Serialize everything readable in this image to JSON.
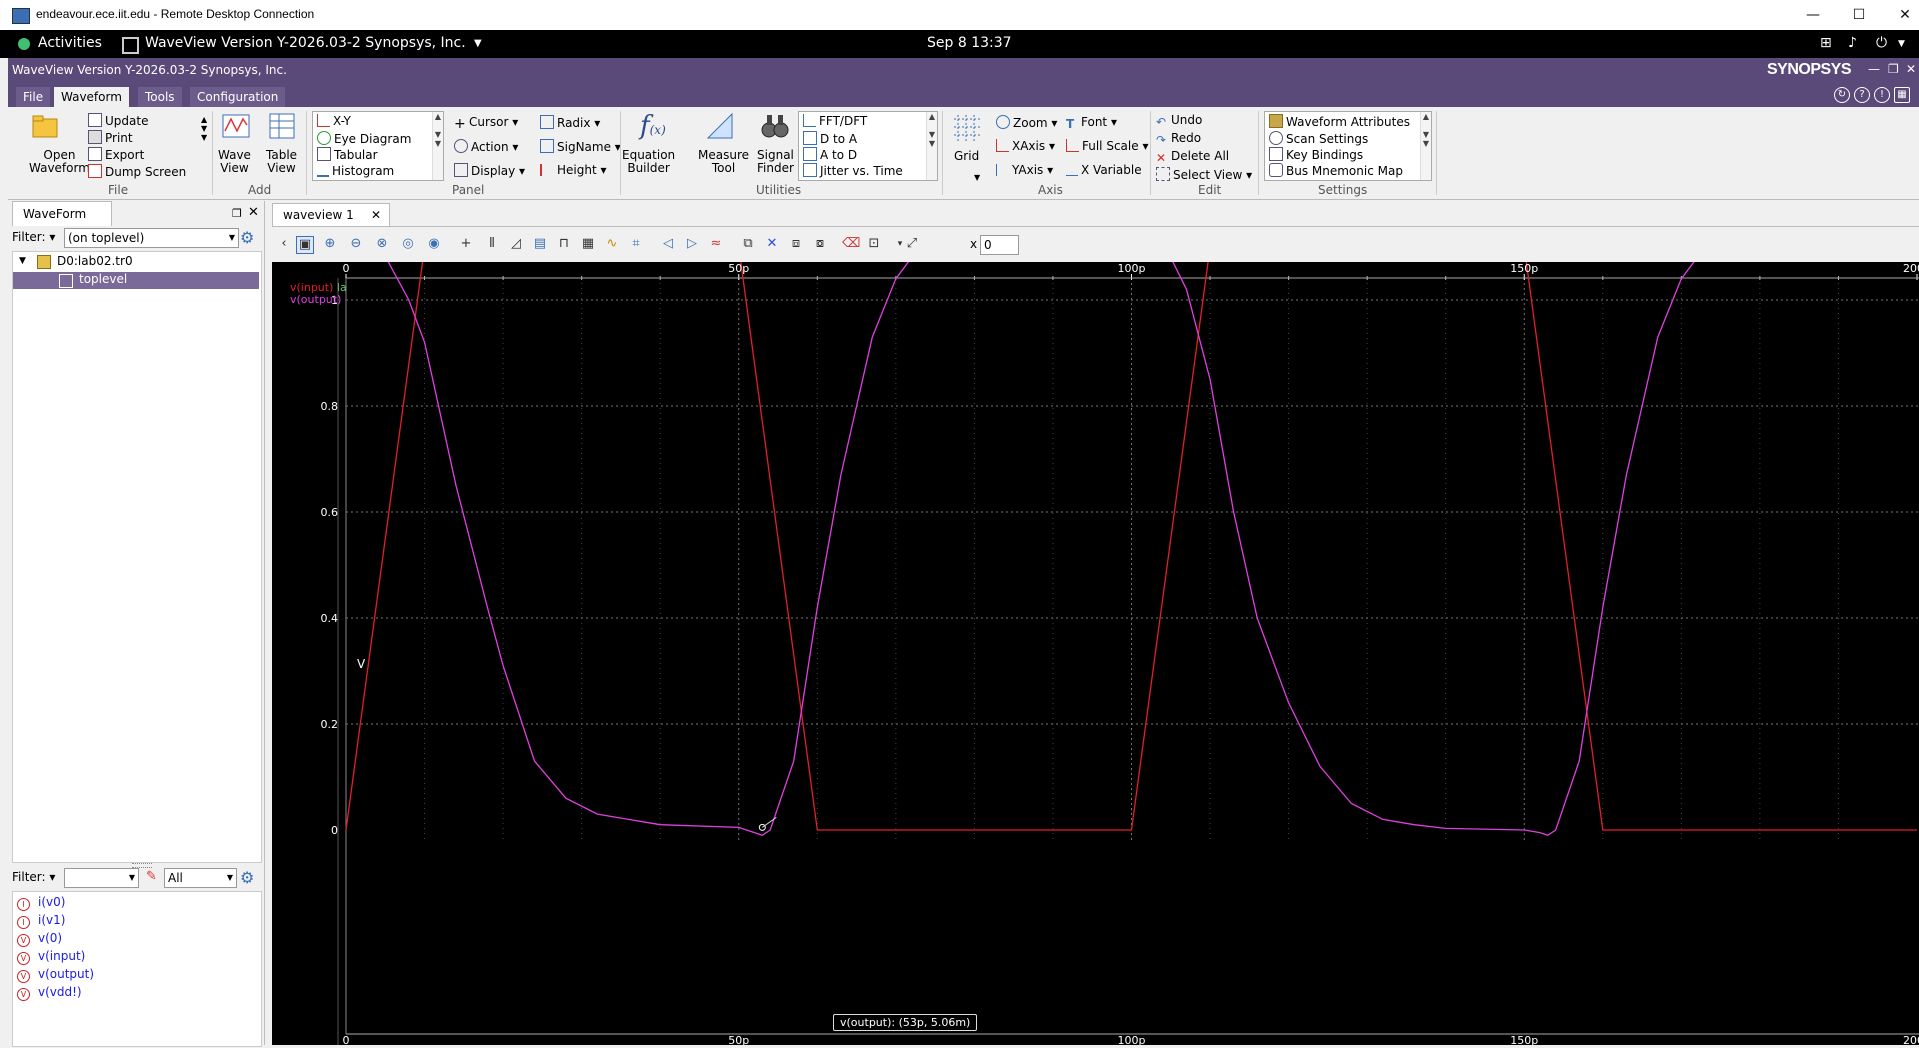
{
  "rdp": {
    "title": "endeavour.ece.iit.edu - Remote Desktop Connection",
    "min": "—",
    "max": "☐",
    "close": "✕"
  },
  "gnome": {
    "activities": "Activities",
    "app": "WaveView Version Y-2026.03-2 Synopsys, Inc.",
    "clock": "Sep 8  13:37"
  },
  "app": {
    "title": "WaveView Version Y-2026.03-2 Synopsys, Inc.",
    "logo": "SYNOPSYS"
  },
  "menu": [
    "File",
    "Waveform",
    "Tools",
    "Configuration"
  ],
  "ribbon": {
    "file": {
      "open": [
        "Open",
        "Waveform"
      ],
      "items": [
        "Update",
        "Print",
        "Export",
        "Dump Screen"
      ],
      "group": "File"
    },
    "add": {
      "wave": [
        "Wave",
        "View"
      ],
      "table": [
        "Table",
        "View"
      ],
      "group": "Add"
    },
    "panel": {
      "list": [
        "X-Y",
        "Eye Diagram",
        "Tabular",
        "Histogram"
      ],
      "col1": [
        "Cursor",
        "Action",
        "Display"
      ],
      "col2": [
        "Radix",
        "SigName",
        "Height"
      ],
      "group": "Panel"
    },
    "utilities": {
      "eq": [
        "Equation",
        "Builder"
      ],
      "measure": [
        "Measure",
        "Tool"
      ],
      "signal": [
        "Signal",
        "Finder"
      ],
      "list": [
        "FFT/DFT",
        "D to A",
        "A to D",
        "Jitter vs. Time"
      ],
      "group": "Utilities"
    },
    "axis": {
      "grid": "Grid",
      "col1": [
        "Zoom",
        "XAxis",
        "YAxis"
      ],
      "col2": [
        "Font",
        "Full Scale",
        "X Variable"
      ],
      "group": "Axis"
    },
    "edit": {
      "items": [
        "Undo",
        "Redo",
        "Delete All",
        "Select View"
      ],
      "group": "Edit"
    },
    "settings": {
      "items": [
        "Waveform Attributes",
        "Scan Settings",
        "Key Bindings",
        "Bus Mnemonic Map"
      ],
      "group": "Settings"
    }
  },
  "left": {
    "tab": "WaveForm",
    "filter_label": "Filter:",
    "filter_value": "(on toplevel)",
    "tree": [
      "D0:lab02.tr0",
      "toplevel"
    ],
    "filter2_label": "Filter:",
    "filter2_all": "All",
    "signals": [
      "i(v0)",
      "i(v1)",
      "v(0)",
      "v(input)",
      "v(output)",
      "v(vdd!)"
    ]
  },
  "wave": {
    "tab": "waveview 1",
    "x_label": "x",
    "x_value": "0"
  },
  "chart_data": {
    "type": "line",
    "ylabel": "V",
    "xlabel": "",
    "xlim": [
      0,
      200
    ],
    "ylim": [
      0,
      1.1
    ],
    "x_ticks": [
      "0",
      "50p",
      "100p",
      "150p",
      "200p"
    ],
    "y_ticks": [
      "0",
      "0.2",
      "0.4",
      "0.6",
      "0.8",
      "1"
    ],
    "grid": true,
    "legend": [
      "v(input)",
      "v(output)"
    ],
    "legend_extra": "la",
    "series": [
      {
        "name": "v(input)",
        "color": "#e0202a",
        "x": [
          0,
          10,
          50,
          60,
          100,
          110,
          150,
          160,
          200
        ],
        "y": [
          0,
          1.1,
          1.1,
          0,
          0,
          1.1,
          1.1,
          0,
          0
        ]
      },
      {
        "name": "v(output)",
        "color": "#e040e0",
        "x": [
          0,
          2,
          4,
          8,
          10,
          14,
          18,
          20,
          24,
          28,
          32,
          40,
          50,
          52,
          53,
          54,
          57,
          60,
          63,
          65,
          67,
          70,
          72,
          75,
          80,
          90,
          100,
          102,
          103,
          104,
          107,
          110,
          113,
          116,
          120,
          124,
          128,
          132,
          136,
          140,
          150,
          152,
          153,
          154,
          157,
          160,
          163,
          165,
          167,
          170,
          172,
          175,
          180,
          190,
          200
        ],
        "y": [
          1.08,
          1.11,
          1.11,
          1.0,
          0.92,
          0.65,
          0.42,
          0.31,
          0.13,
          0.06,
          0.03,
          0.01,
          0.005,
          -0.005,
          -0.01,
          0.0,
          0.13,
          0.42,
          0.67,
          0.8,
          0.93,
          1.04,
          1.08,
          1.095,
          1.1,
          1.1,
          1.1,
          1.12,
          1.13,
          1.11,
          1.02,
          0.85,
          0.6,
          0.4,
          0.24,
          0.12,
          0.05,
          0.02,
          0.01,
          0.003,
          0.0,
          -0.005,
          -0.01,
          0.0,
          0.13,
          0.42,
          0.67,
          0.8,
          0.93,
          1.04,
          1.08,
          1.095,
          1.1,
          1.1,
          1.1
        ]
      }
    ],
    "tooltip": "v(output): (53p, 5.06m)"
  }
}
